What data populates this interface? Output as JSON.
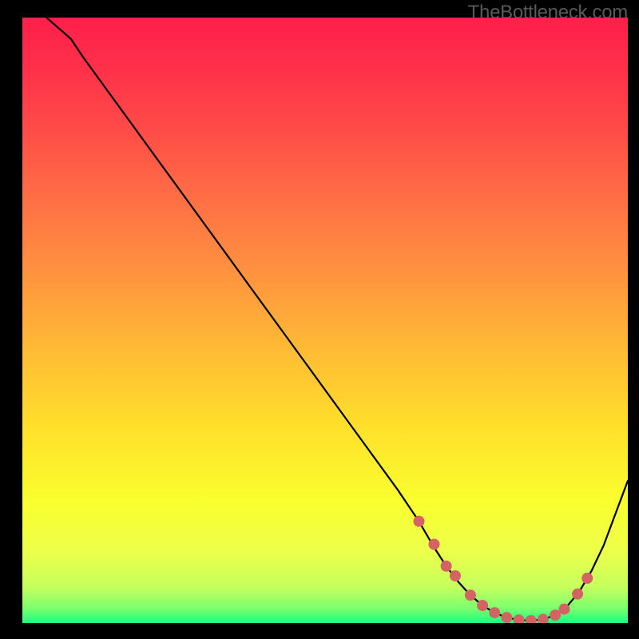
{
  "watermark": "TheBottleneck.com",
  "chart_data": {
    "type": "line",
    "title": "",
    "xlabel": "",
    "ylabel": "",
    "xlim": [
      0,
      100
    ],
    "ylim": [
      0,
      100
    ],
    "series": [
      {
        "name": "curve",
        "x": [
          4,
          8,
          10,
          14,
          18,
          22,
          26,
          30,
          34,
          38,
          42,
          46,
          50,
          54,
          58,
          62,
          65.5,
          68,
          70,
          72,
          74,
          76,
          78,
          80,
          82,
          84,
          86,
          88,
          90,
          92,
          94,
          96,
          100
        ],
        "y": [
          100,
          96.5,
          93.5,
          88,
          82.5,
          77,
          71.5,
          66,
          60.5,
          55,
          49.5,
          44,
          38.5,
          33,
          27.5,
          22,
          16.8,
          12.5,
          9.4,
          6.8,
          4.6,
          2.9,
          1.7,
          0.9,
          0.5,
          0.4,
          0.6,
          1.3,
          2.8,
          5.2,
          8.6,
          12.8,
          23.5
        ]
      }
    ],
    "markers": {
      "name": "bottom-cluster",
      "color": "#d46363",
      "points": [
        {
          "x": 65.5,
          "y": 16.8
        },
        {
          "x": 68.0,
          "y": 13.0
        },
        {
          "x": 70.0,
          "y": 9.4
        },
        {
          "x": 71.5,
          "y": 7.8
        },
        {
          "x": 74.0,
          "y": 4.6
        },
        {
          "x": 76.0,
          "y": 2.9
        },
        {
          "x": 78.0,
          "y": 1.7
        },
        {
          "x": 80.0,
          "y": 0.9
        },
        {
          "x": 82.0,
          "y": 0.5
        },
        {
          "x": 84.0,
          "y": 0.4
        },
        {
          "x": 86.0,
          "y": 0.6
        },
        {
          "x": 88.0,
          "y": 1.3
        },
        {
          "x": 89.5,
          "y": 2.3
        },
        {
          "x": 91.7,
          "y": 4.8
        },
        {
          "x": 93.3,
          "y": 7.4
        }
      ]
    },
    "gradient_stops": [
      {
        "offset": 0.0,
        "color": "#ff1f4b"
      },
      {
        "offset": 0.08,
        "color": "#ff2f4a"
      },
      {
        "offset": 0.18,
        "color": "#ff4a48"
      },
      {
        "offset": 0.3,
        "color": "#ff6f45"
      },
      {
        "offset": 0.42,
        "color": "#ff923f"
      },
      {
        "offset": 0.55,
        "color": "#ffbb35"
      },
      {
        "offset": 0.68,
        "color": "#ffe12a"
      },
      {
        "offset": 0.8,
        "color": "#f9ff2f"
      },
      {
        "offset": 0.88,
        "color": "#edff49"
      },
      {
        "offset": 0.94,
        "color": "#c6ff5d"
      },
      {
        "offset": 0.975,
        "color": "#7dff6d"
      },
      {
        "offset": 1.0,
        "color": "#1cff82"
      }
    ]
  }
}
